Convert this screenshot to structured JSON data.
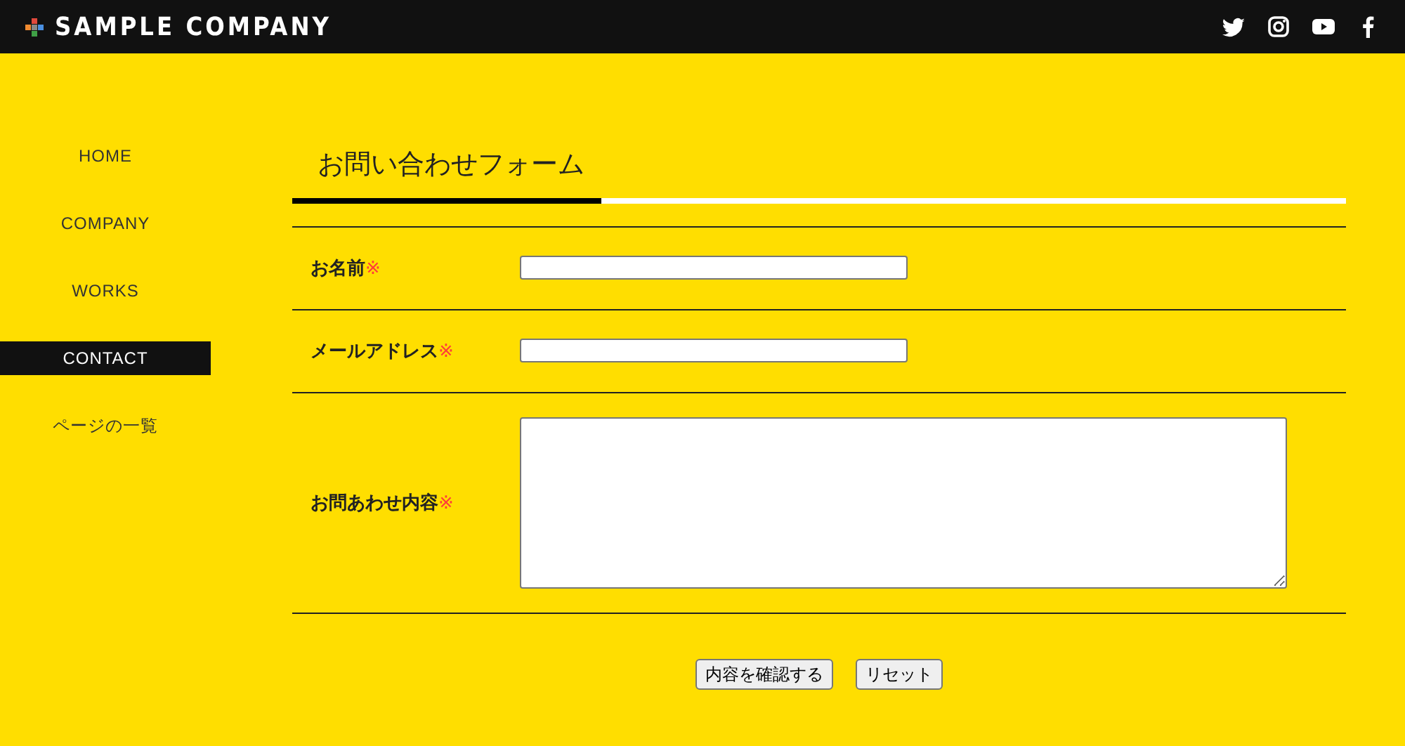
{
  "header": {
    "logo_text": "SAMPLE COMPANY"
  },
  "sidebar": {
    "items": [
      {
        "label": "HOME",
        "selected": false
      },
      {
        "label": "COMPANY",
        "selected": false
      },
      {
        "label": "WORKS",
        "selected": false
      },
      {
        "label": "CONTACT",
        "selected": true
      },
      {
        "label": "ページの一覧",
        "selected": false
      }
    ]
  },
  "form": {
    "title": "お問い合わせフォーム",
    "fields": [
      {
        "label": "お名前",
        "required_mark": "※",
        "kind": "text"
      },
      {
        "label": "メールアドレス",
        "required_mark": "※",
        "kind": "text"
      },
      {
        "label": "お問あわせ内容",
        "required_mark": "※",
        "kind": "textarea"
      }
    ],
    "buttons": [
      "内容を確認する",
      "リセット"
    ]
  }
}
